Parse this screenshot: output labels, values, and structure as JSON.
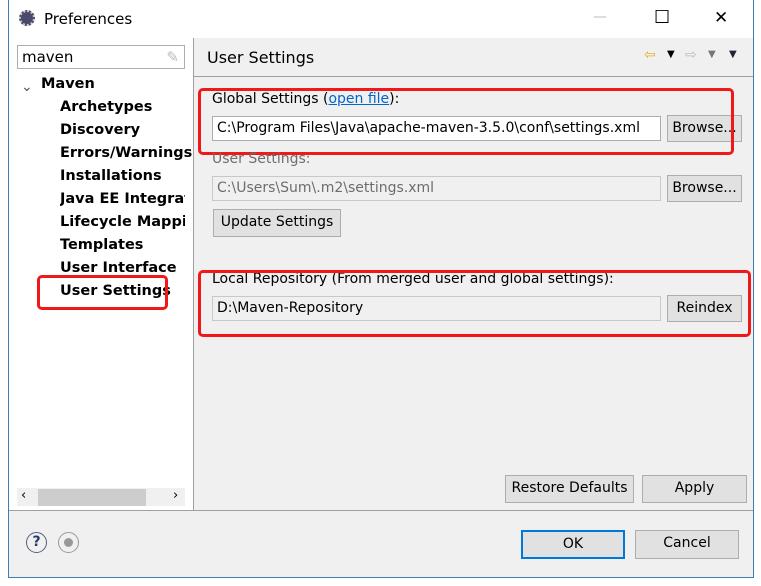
{
  "window": {
    "title": "Preferences",
    "minimize": "—",
    "maximize": "☐",
    "close": "✕"
  },
  "filter": {
    "value": "maven"
  },
  "tree": {
    "root": "Maven",
    "items": [
      "Archetypes",
      "Discovery",
      "Errors/Warnings",
      "Installations",
      "Java EE Integrati",
      "Lifecycle Mappin",
      "Templates",
      "User Interface",
      "User Settings"
    ],
    "selected": "User Settings"
  },
  "page": {
    "title": "User Settings",
    "global_label": "Global Settings (",
    "global_link": "open file",
    "global_label_end": "):",
    "global_value": "C:\\Program Files\\Java\\apache-maven-3.5.0\\conf\\settings.xml",
    "browse": "Browse...",
    "user_label": "User Settings:",
    "user_value": "C:\\Users\\Sum\\.m2\\settings.xml",
    "update": "Update Settings",
    "local_label": "Local Repository (From merged user and global settings):",
    "local_value": "D:\\Maven-Repository",
    "reindex": "Reindex",
    "restore": "Restore Defaults",
    "apply": "Apply"
  },
  "footer": {
    "ok": "OK",
    "cancel": "Cancel"
  },
  "colors": {
    "highlight": "#f01818",
    "link": "#0066cc",
    "ok_border": "#0078d7"
  }
}
